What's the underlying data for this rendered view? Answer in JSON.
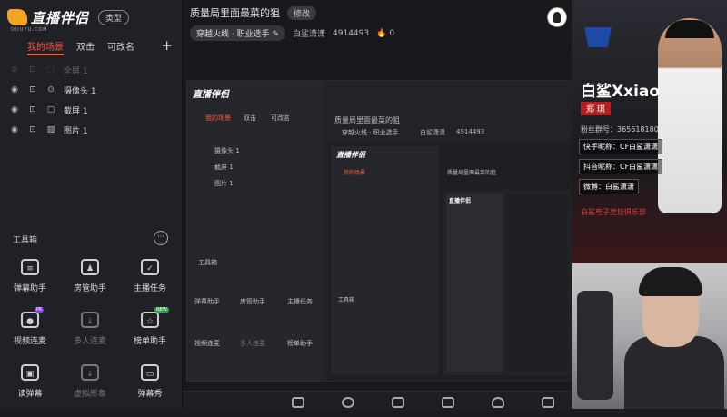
{
  "app": {
    "logo_text": "直播伴侣",
    "logo_sub": "DOUYU.COM",
    "type_button": "类型"
  },
  "tabs": [
    "我的场景",
    "双击",
    "可改名"
  ],
  "tab_plus": "+",
  "scene_items": [
    {
      "label": "全屏 1",
      "dim": true
    },
    {
      "label": "摄像头 1",
      "dim": false
    },
    {
      "label": "截屏 1",
      "dim": false
    },
    {
      "label": "图片 1",
      "dim": false
    }
  ],
  "toolbox": {
    "title": "工具箱",
    "more": "···",
    "tools": [
      {
        "label": "弹幕助手",
        "icon": "danmaku-helper-icon",
        "glyph": "≡"
      },
      {
        "label": "房管助手",
        "icon": "room-admin-icon",
        "glyph": "♟"
      },
      {
        "label": "主播任务",
        "icon": "streamer-task-icon",
        "glyph": "✓"
      },
      {
        "label": "视频连麦",
        "icon": "video-mic-icon",
        "glyph": "●",
        "badge": "PK"
      },
      {
        "label": "多人连麦",
        "icon": "multi-mic-icon",
        "glyph": "↓",
        "disabled": true
      },
      {
        "label": "榜单助手",
        "icon": "ranking-helper-icon",
        "glyph": "☆",
        "badge": "NEW"
      },
      {
        "label": "读弹幕",
        "icon": "read-danmaku-icon",
        "glyph": "▣"
      },
      {
        "label": "虚拟形象",
        "icon": "virtual-avatar-icon",
        "glyph": "↓",
        "disabled": true
      },
      {
        "label": "弹幕秀",
        "icon": "danmaku-show-icon",
        "glyph": "▭"
      }
    ]
  },
  "room": {
    "title": "质量局里面最菜的狙",
    "edit": "修改",
    "category": "穿越火线 · 职业选手",
    "nickname": "白鲨潇潇",
    "room_id": "4914493",
    "heat": "0"
  },
  "promo": {
    "name_en": "白鲨Xxiao",
    "name_cn": "郑 琪",
    "fan_group": "粉丝群号：365618180",
    "kuaishou": "快手昵称：CF白鲨潇潇",
    "douyin": "抖音昵称：CF白鲨潇潇",
    "weibo": "微博：白鲨潇潇",
    "club": "白鲨电子竞技俱乐部"
  },
  "colors": {
    "accent": "#ff5a3c",
    "panel": "#202126",
    "background": "#18191c"
  }
}
